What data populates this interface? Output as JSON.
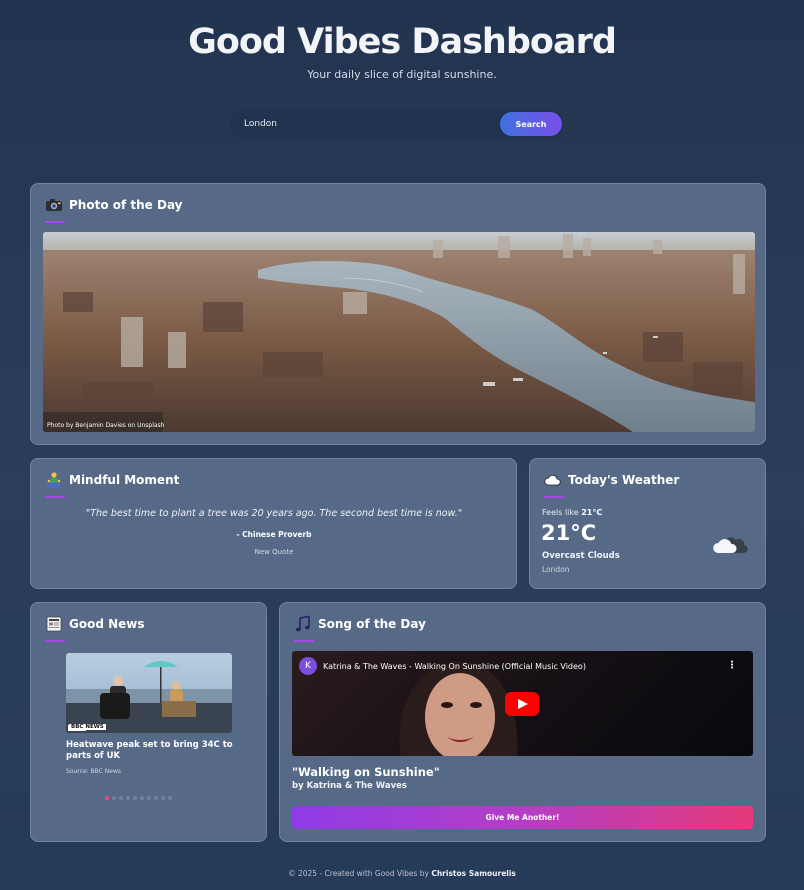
{
  "header": {
    "title": "Good Vibes Dashboard",
    "subtitle": "Your daily slice of digital sunshine."
  },
  "search": {
    "value": "London",
    "button_label": "Search"
  },
  "photo": {
    "title": "Photo of the Day",
    "icon": "camera-icon",
    "credit": "Photo by Benjamin Davies on Unsplash"
  },
  "mindful": {
    "title": "Mindful Moment",
    "icon": "meditation-icon",
    "quote": "\"The best time to plant a tree was 20 years ago. The second best time is now.\"",
    "author": "- Chinese Proverb",
    "new_quote_label": "New Quote"
  },
  "weather": {
    "title": "Today's Weather",
    "icon": "cloud-icon",
    "feels_like_label": "Feels like",
    "feels_like_value": "21°C",
    "temperature": "21°C",
    "condition": "Overcast Clouds",
    "location": "London"
  },
  "news": {
    "title": "Good News",
    "icon": "newspaper-icon",
    "image_caption": "BBC NEWS",
    "headline": "Heatwave peak set to bring 34C to parts of UK",
    "source": "Source: BBC News",
    "active_index": 0,
    "slide_count": 10
  },
  "song": {
    "title": "Song of the Day",
    "icon": "music-note-icon",
    "video_title": "Katrina & The Waves - Walking On Sunshine (Official Music Video)",
    "channel_initial": "K",
    "song_name": "\"Walking on Sunshine\"",
    "artist": "by Katrina & The Waves",
    "another_label": "Give Me Another!"
  },
  "footer": {
    "prefix": "© 2025 - Created with Good Vibes by",
    "author": "Christos Samourelis"
  },
  "colors": {
    "accent": "#a448e8",
    "search_button": "#5a62e4",
    "another_button_start": "#8f3be6",
    "another_button_end": "#e33a7a",
    "card_bg": "#566a87",
    "page_bg": "#22344f"
  }
}
